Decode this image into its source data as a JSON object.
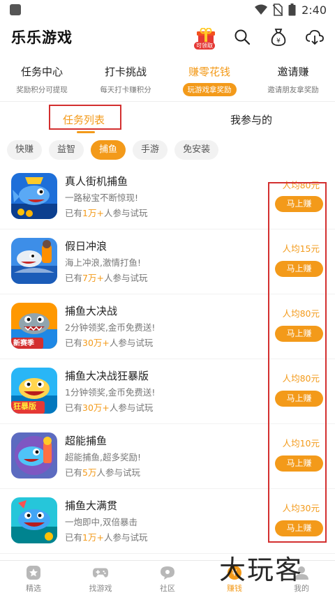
{
  "status": {
    "time": "2:40"
  },
  "app": {
    "title": "乐乐游戏",
    "gift_badge": "可领取"
  },
  "main_tabs": [
    {
      "title": "任务中心",
      "sub": "奖励积分可提现"
    },
    {
      "title": "打卡挑战",
      "sub": "每天打卡赚积分"
    },
    {
      "title": "赚零花钱",
      "sub": "玩游戏拿奖励",
      "active": true
    },
    {
      "title": "邀请赚",
      "sub": "邀请朋友拿奖励"
    }
  ],
  "sub_tabs": [
    {
      "label": "任务列表",
      "active": true
    },
    {
      "label": "我参与的"
    }
  ],
  "chips": [
    "快赚",
    "益智",
    "捕鱼",
    "手游",
    "免安装"
  ],
  "active_chip": "捕鱼",
  "items": [
    {
      "title": "真人街机捕鱼",
      "desc": "一路秘宝不断惊现!",
      "count_pre": "已有",
      "count_num": "1万+",
      "count_post": "人参与试玩",
      "price": "人均80元",
      "button": "马上赚",
      "thumb_badge": ""
    },
    {
      "title": "假日冲浪",
      "desc": "海上冲浪,激情打鱼!",
      "count_pre": "已有",
      "count_num": "7万+",
      "count_post": "人参与试玩",
      "price": "人均15元",
      "button": "马上赚",
      "thumb_badge": ""
    },
    {
      "title": "捕鱼大决战",
      "desc": "2分钟领奖,金币免费送!",
      "count_pre": "已有",
      "count_num": "30万+",
      "count_post": "人参与试玩",
      "price": "人均80元",
      "button": "马上赚",
      "thumb_badge": "新赛季"
    },
    {
      "title": "捕鱼大决战狂暴版",
      "desc": "1分钟领奖,金币免费送!",
      "count_pre": "已有",
      "count_num": "30万+",
      "count_post": "人参与试玩",
      "price": "人均80元",
      "button": "马上赚",
      "thumb_badge": "狂暴版"
    },
    {
      "title": "超能捕鱼",
      "desc": "超能捕鱼,超多奖励!",
      "count_pre": "已有",
      "count_num": "5万",
      "count_post": "人参与试玩",
      "price": "人均10元",
      "button": "马上赚",
      "thumb_badge": ""
    },
    {
      "title": "捕鱼大满贯",
      "desc": "一炮即中,双倍暴击",
      "count_pre": "已有",
      "count_num": "1万+",
      "count_post": "人参与试玩",
      "price": "人均30元",
      "button": "马上赚",
      "thumb_badge": ""
    }
  ],
  "bottom_nav": [
    {
      "label": "精选",
      "icon": "star-icon"
    },
    {
      "label": "找游戏",
      "icon": "gamepad-icon"
    },
    {
      "label": "社区",
      "icon": "chat-icon"
    },
    {
      "label": "赚钱",
      "icon": "coin-icon",
      "active": true
    },
    {
      "label": "我的",
      "icon": "user-icon"
    }
  ],
  "watermark": "大玩客",
  "colors": {
    "accent": "#f39a1a",
    "highlight_box": "#d32f2f"
  }
}
